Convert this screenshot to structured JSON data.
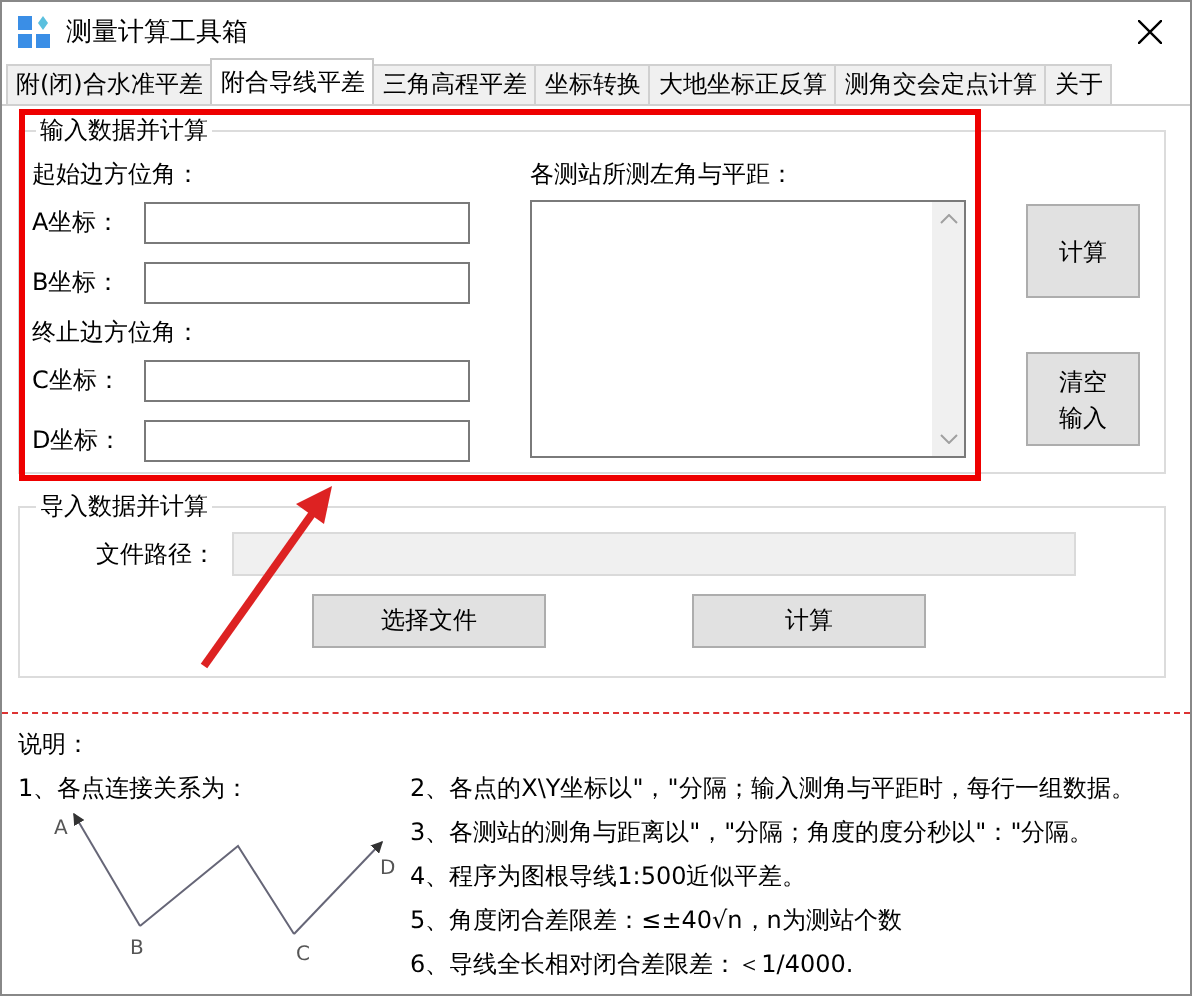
{
  "window": {
    "title": "测量计算工具箱"
  },
  "tabs": [
    {
      "label": "附(闭)合水准平差",
      "selected": false
    },
    {
      "label": "附合导线平差",
      "selected": true
    },
    {
      "label": "三角高程平差",
      "selected": false
    },
    {
      "label": "坐标转换",
      "selected": false
    },
    {
      "label": "大地坐标正反算",
      "selected": false
    },
    {
      "label": "测角交会定点计算",
      "selected": false
    },
    {
      "label": "关于",
      "selected": false
    }
  ],
  "input_group": {
    "title": "输入数据并计算",
    "start_azimuth_label": "起始边方位角：",
    "start_fields": [
      {
        "label": "A坐标："
      },
      {
        "label": "B坐标："
      }
    ],
    "end_azimuth_label": "终止边方位角：",
    "end_fields": [
      {
        "label": "C坐标："
      },
      {
        "label": "D坐标："
      }
    ],
    "observations_label": "各测站所测左角与平距：",
    "buttons": [
      "计算",
      "清空输入"
    ]
  },
  "import_group": {
    "title": "导入数据并计算",
    "path_label": "文件路径：",
    "buttons": [
      "选择文件",
      "计算"
    ]
  },
  "notes": {
    "title": "说明：",
    "items": [
      "1、各点连接关系为：",
      "2、各点的X\\Y坐标以\"，\"分隔；输入测角与平距时，每行一组数据。",
      "3、各测站的测角与距离以\"，\"分隔；角度的度分秒以\"：\"分隔。",
      "4、程序为图根导线1:500近似平差。",
      "5、角度闭合差限差：≤±40√n，n为测站个数",
      "6、导线全长相对闭合差限差：＜1/4000."
    ],
    "diagram_points": [
      "A",
      "B",
      "C",
      "D"
    ]
  }
}
